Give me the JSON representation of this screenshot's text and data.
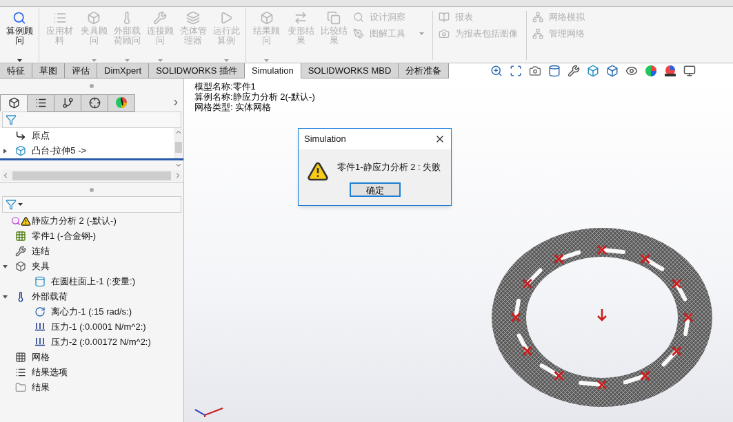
{
  "ribbon": {
    "large_buttons": [
      {
        "label": "算例顾问",
        "disabled": false,
        "dropdown": true,
        "group_start": false
      },
      {
        "label": "应用材料",
        "disabled": true,
        "dropdown": false,
        "group_start": true
      },
      {
        "label": "夹具顾问",
        "disabled": true,
        "dropdown": true,
        "group_start": false
      },
      {
        "label": "外部载荷顾问",
        "disabled": true,
        "dropdown": true,
        "group_start": false
      },
      {
        "label": "连接顾问",
        "disabled": true,
        "dropdown": true,
        "group_start": false
      },
      {
        "label": "壳体管理器",
        "disabled": true,
        "dropdown": false,
        "group_start": false
      },
      {
        "label": "运行此算例",
        "disabled": true,
        "dropdown": true,
        "group_start": false
      },
      {
        "label": "结果顾问",
        "disabled": true,
        "dropdown": true,
        "group_start": true
      },
      {
        "label": "变形结果",
        "disabled": true,
        "dropdown": false,
        "group_start": false
      },
      {
        "label": "比较结果",
        "disabled": true,
        "dropdown": false,
        "group_start": false
      }
    ],
    "small_columns": [
      [
        {
          "label": "设计洞察",
          "disabled": true,
          "dropdown": false
        },
        {
          "label": "图解工具",
          "disabled": true,
          "dropdown": true
        }
      ],
      [
        {
          "label": "报表",
          "disabled": true,
          "dropdown": false
        },
        {
          "label": "为报表包括图像",
          "disabled": true,
          "dropdown": false
        }
      ],
      [
        {
          "label": "网络模拟",
          "disabled": true,
          "dropdown": false
        },
        {
          "label": "管理网络",
          "disabled": true,
          "dropdown": false
        }
      ]
    ]
  },
  "tabs": [
    {
      "label": "特征",
      "selected": false
    },
    {
      "label": "草图",
      "selected": false
    },
    {
      "label": "评估",
      "selected": false
    },
    {
      "label": "DimXpert",
      "selected": false
    },
    {
      "label": "SOLIDWORKS 插件",
      "selected": false
    },
    {
      "label": "Simulation",
      "selected": true
    },
    {
      "label": "SOLIDWORKS MBD",
      "selected": false
    },
    {
      "label": "分析准备",
      "selected": false
    }
  ],
  "panel_tabs": [
    {
      "selected": true
    },
    {
      "selected": false
    },
    {
      "selected": false
    },
    {
      "selected": false
    },
    {
      "selected": false
    }
  ],
  "feature_tree": [
    {
      "label": "原点"
    },
    {
      "label": "凸台-拉伸5 ->",
      "expanded": false
    }
  ],
  "study_tree": [
    {
      "label": "静应力分析 2 (-默认-)"
    },
    {
      "label": "零件1 (-合金钢-)"
    },
    {
      "label": "连结"
    },
    {
      "label": "夹具",
      "expanded": true,
      "children": [
        {
          "label": "在圆柱面上-1 (:变量:)"
        }
      ]
    },
    {
      "label": "外部载荷",
      "expanded": true,
      "children": [
        {
          "label": "离心力-1 (:15 rad/s:)"
        },
        {
          "label": "压力-1 (:0.0001 N/m^2:)"
        },
        {
          "label": "压力-2 (:0.00172 N/m^2:)"
        }
      ]
    },
    {
      "label": "网格"
    },
    {
      "label": "结果选项"
    },
    {
      "label": "结果"
    }
  ],
  "viewport": {
    "info_lines": [
      "模型名称:零件1",
      "算例名称:静应力分析 2(-默认-)",
      "网格类型: 实体网格"
    ]
  },
  "dialog": {
    "title": "Simulation",
    "message": "零件1-静应力分析 2 : 失败",
    "button": "确定"
  }
}
